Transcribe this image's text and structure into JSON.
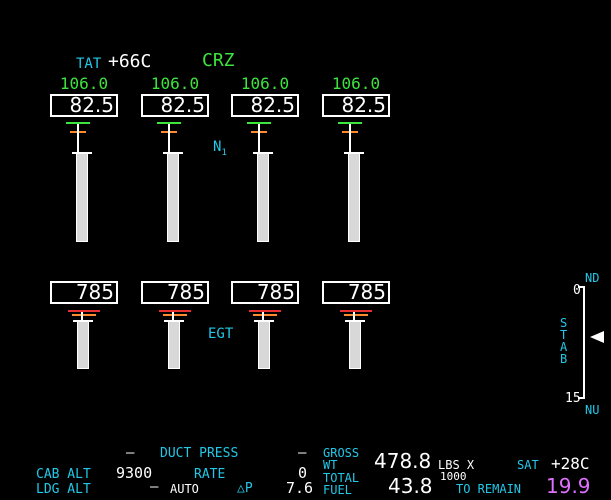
{
  "header": {
    "tat_label": "TAT",
    "tat_value": "+66C",
    "mode": "CRZ"
  },
  "n1": {
    "label": "N",
    "label_sub": "1",
    "engines": [
      {
        "limit": "106.0",
        "value": "82.5"
      },
      {
        "limit": "106.0",
        "value": "82.5"
      },
      {
        "limit": "106.0",
        "value": "82.5"
      },
      {
        "limit": "106.0",
        "value": "82.5"
      }
    ]
  },
  "egt": {
    "label": "EGT",
    "engines": [
      {
        "value": "785"
      },
      {
        "value": "785"
      },
      {
        "value": "785"
      },
      {
        "value": "785"
      }
    ]
  },
  "stab": {
    "top_label": "ND",
    "bottom_label": "NU",
    "scale_top": "0",
    "scale_bottom": "15",
    "letters": [
      "S",
      "T",
      "A",
      "B"
    ]
  },
  "bottom": {
    "duct_left_dash": "–",
    "duct_label": "DUCT PRESS",
    "duct_right_dash": "–",
    "cab_alt_label": "CAB ALT",
    "cab_alt_value": "9300",
    "rate_label": "RATE",
    "rate_value": "0",
    "ldg_alt_label": "LDG ALT",
    "ldg_alt_dash": "–",
    "auto_label": "AUTO",
    "dp_label": "△P",
    "dp_value": "7.6",
    "gross_label": "GROSS",
    "wt_label": "WT",
    "gross_value": "478.8",
    "total_label": "TOTAL",
    "fuel_label": "FUEL",
    "fuel_value": "43.8",
    "units_label": "LBS X",
    "units_mult": "1000",
    "sat_label": "SAT",
    "sat_value": "+28C",
    "to_remain_label": "TO REMAIN",
    "to_remain_value": "19.9"
  }
}
